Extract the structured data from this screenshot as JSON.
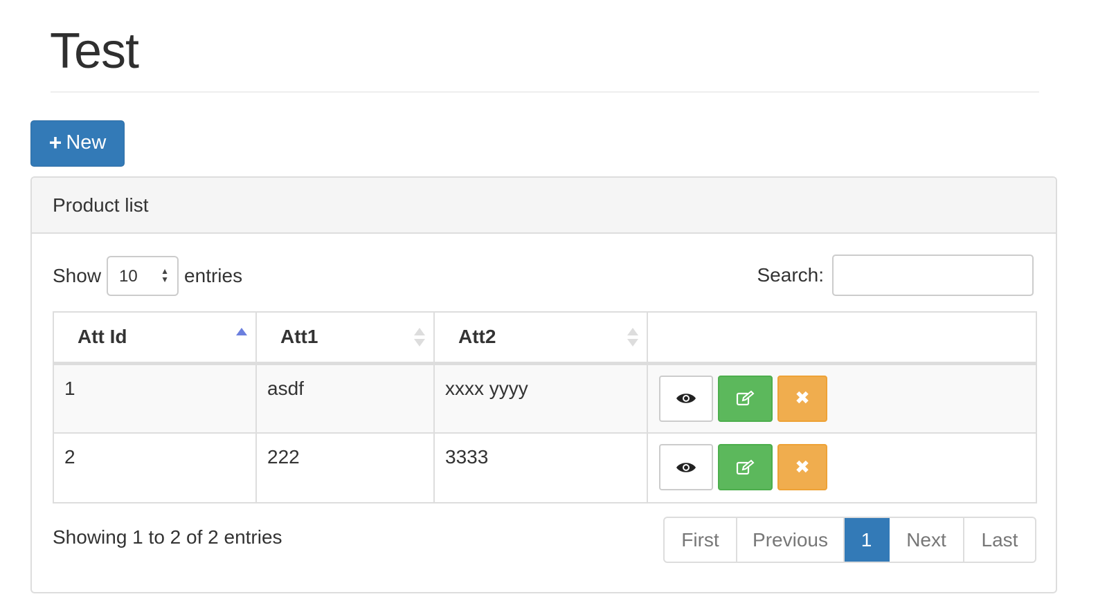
{
  "header": {
    "title": "Test"
  },
  "toolbar": {
    "new_label": "New",
    "new_icon": "plus-icon"
  },
  "panel": {
    "title": "Product list"
  },
  "controls": {
    "show_label": "Show",
    "entries_label": "entries",
    "page_length_value": "10",
    "search_label": "Search:",
    "search_value": ""
  },
  "table": {
    "columns": [
      {
        "label": "Att Id",
        "sort": "asc"
      },
      {
        "label": "Att1",
        "sort": "both"
      },
      {
        "label": "Att2",
        "sort": "both"
      },
      {
        "label": ""
      }
    ],
    "rows": [
      {
        "id": "1",
        "att1": "asdf",
        "att2": "xxxx yyyy"
      },
      {
        "id": "2",
        "att1": "222",
        "att2": "3333"
      }
    ],
    "row_actions": [
      {
        "name": "view",
        "icon": "eye-icon"
      },
      {
        "name": "edit",
        "icon": "pencil-square-icon"
      },
      {
        "name": "delete",
        "icon": "close-icon",
        "glyph": "✖"
      }
    ]
  },
  "footer": {
    "info": "Showing 1 to 2 of 2 entries",
    "pagination": [
      "First",
      "Previous",
      "1",
      "Next",
      "Last"
    ],
    "current_page": "1"
  },
  "colors": {
    "primary": "#337ab7",
    "success": "#5cb85c",
    "warning": "#f0ad4e",
    "sort_active": "#6b7fde"
  }
}
